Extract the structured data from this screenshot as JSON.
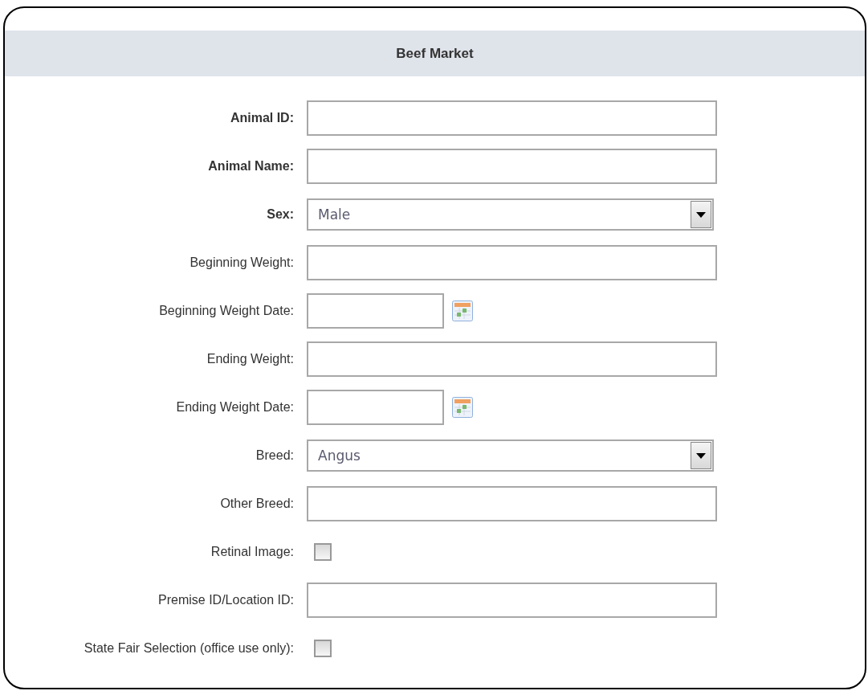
{
  "form": {
    "title": "Beef Market",
    "fields": [
      {
        "kind": "text",
        "label": "Animal ID:",
        "required": true
      },
      {
        "kind": "text",
        "label": "Animal Name:",
        "required": true
      },
      {
        "kind": "select",
        "label": "Sex:",
        "required": true,
        "value": "Male"
      },
      {
        "kind": "text",
        "label": "Beginning Weight:",
        "required": false
      },
      {
        "kind": "date",
        "label": "Beginning Weight Date:",
        "required": false
      },
      {
        "kind": "text",
        "label": "Ending Weight:",
        "required": false
      },
      {
        "kind": "date",
        "label": "Ending Weight Date:",
        "required": false
      },
      {
        "kind": "select",
        "label": "Breed:",
        "required": false,
        "value": "Angus"
      },
      {
        "kind": "text",
        "label": "Other Breed:",
        "required": false
      },
      {
        "kind": "checkbox",
        "label": "Retinal Image:",
        "required": false,
        "checked": false
      },
      {
        "kind": "text",
        "label": "Premise ID/Location ID:",
        "required": false
      },
      {
        "kind": "checkbox",
        "label": "State Fair Selection (office use only):",
        "required": false,
        "checked": false
      }
    ]
  }
}
